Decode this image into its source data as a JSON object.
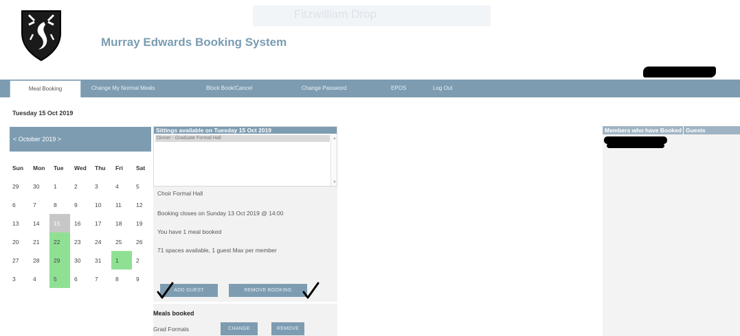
{
  "header": {
    "title": "Murray Edwards Booking System",
    "ghost_text": "Fitzwilliam Drop"
  },
  "nav": {
    "items": [
      {
        "label": "Meal Booking",
        "active": true
      },
      {
        "label": "Change My Normal Meals",
        "active": false
      },
      {
        "label": "Block Book/Cancel",
        "active": false
      },
      {
        "label": "Change Password",
        "active": false
      },
      {
        "label": "EPOS",
        "active": false
      },
      {
        "label": "Log Out",
        "active": false
      }
    ]
  },
  "date_heading": "Tuesday 15 Oct 2019",
  "calendar": {
    "month_label": "< October 2019 >",
    "weekdays": [
      "Sun",
      "Mon",
      "Tue",
      "Wed",
      "Thu",
      "Fri",
      "Sat"
    ],
    "weeks": [
      [
        "29",
        "30",
        "1",
        "2",
        "3",
        "4",
        "5"
      ],
      [
        "6",
        "7",
        "8",
        "9",
        "10",
        "11",
        "12"
      ],
      [
        "13",
        "14",
        "15",
        "16",
        "17",
        "18",
        "19"
      ],
      [
        "20",
        "21",
        "22",
        "23",
        "24",
        "25",
        "26"
      ],
      [
        "27",
        "28",
        "29",
        "30",
        "31",
        "1",
        "2"
      ],
      [
        "3",
        "4",
        "5",
        "6",
        "7",
        "8",
        "9"
      ]
    ],
    "selected_day": "15",
    "booked_days": [
      "22",
      "29",
      "1",
      "5"
    ],
    "booked_color": "#90e093",
    "selected_color": "#c7c7c7"
  },
  "sittings": {
    "title": "Sittings available on Tuesday 15 Oct 2019",
    "options": [
      "Dinner - Graduate Formal Hall"
    ]
  },
  "info": {
    "line1": "Choir Formal Hall",
    "line2": "Booking closes on Sunday 13 Oct 2019 @ 14:00",
    "line3": "You have 1 meal booked",
    "line4": "71 spaces available, 1 guest Max per member"
  },
  "buttons": {
    "add_guest": "ADD GUEST",
    "remove_booking": "REMOVE BOOKING",
    "change": "CHANGE",
    "remove": "REMOVE"
  },
  "meals": {
    "heading": "Meals booked",
    "items": [
      {
        "name": "Grad Formals"
      }
    ]
  },
  "members": {
    "col1": "Members who have Booked",
    "col2": "Guests"
  },
  "colors": {
    "accent": "#7d9cb1",
    "title": "#7a9cb1"
  }
}
